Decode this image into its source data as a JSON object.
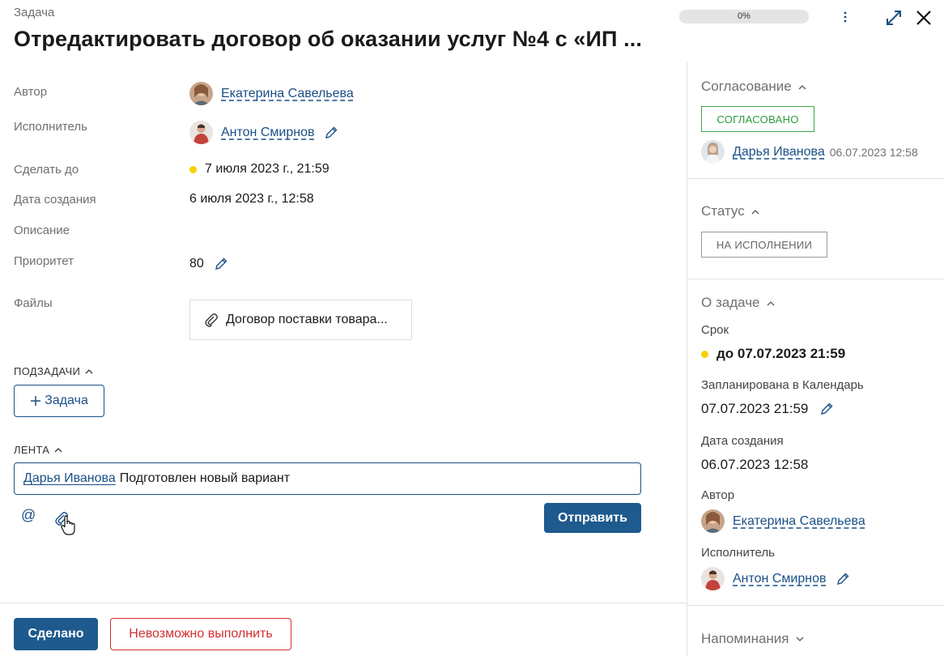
{
  "header": {
    "kind_label": "Задача",
    "title": "Отредактировать договор об оказании услуг №4 с «ИП ...",
    "progress": "0%",
    "progress_value": 0
  },
  "fields": {
    "author_label": "Автор",
    "author_name": "Екатерина Савельева",
    "assignee_label": "Исполнитель",
    "assignee_name": "Антон Смирнов",
    "due_label": "Сделать до",
    "due_value": "7 июля 2023 г., 21:59",
    "created_label": "Дата создания",
    "created_value": "6 июля 2023 г., 12:58",
    "description_label": "Описание",
    "priority_label": "Приоритет",
    "priority_value": "80",
    "files_label": "Файлы",
    "file_name": "Договор поставки товара..."
  },
  "subtasks": {
    "heading": "ПОДЗАДАЧИ",
    "add_label": "Задача"
  },
  "feed": {
    "heading": "ЛЕНТА",
    "mention": "Дарья Иванова",
    "comment_text": "Подготовлен новый вариант",
    "at_symbol": "@",
    "send_label": "Отправить"
  },
  "footer": {
    "done_label": "Сделано",
    "fail_label": "Невозможно выполнить"
  },
  "right_panel": {
    "approval_heading": "Согласование",
    "approval_badge": "СОГЛАСОВАНО",
    "approver_name": "Дарья Иванова",
    "approval_time": "06.07.2023 12:58",
    "status_heading": "Статус",
    "status_badge": "НА ИСПОЛНЕНИИ",
    "about_heading": "О задаче",
    "deadline_label": "Срок",
    "deadline_value": "до 07.07.2023 21:59",
    "calendar_label": "Запланирована в Календарь",
    "calendar_value": "07.07.2023 21:59",
    "created_label": "Дата создания",
    "created_value": "06.07.2023 12:58",
    "author_label": "Автор",
    "author_name": "Екатерина Савельева",
    "assignee_label": "Исполнитель",
    "assignee_name": "Антон Смирнов",
    "reminders_heading": "Напоминания"
  },
  "colors": {
    "primary": "#1e5a8e",
    "link": "#1a4f86",
    "success": "#2e9b3e",
    "danger": "#d32f2f",
    "due_dot": "#f5d100"
  },
  "icons": [
    "more-vertical-icon",
    "expand-icon",
    "close-icon",
    "pencil-icon",
    "paperclip-icon",
    "plus-icon",
    "chevron-up-icon",
    "chevron-down-icon",
    "at-icon",
    "hand-cursor-icon"
  ]
}
